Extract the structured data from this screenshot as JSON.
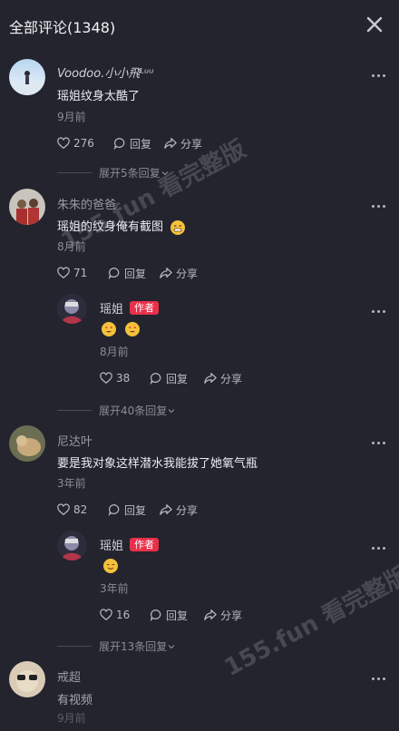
{
  "header": {
    "title": "全部评论(1348)"
  },
  "comments": [
    {
      "name": "Voodoo.小小飛ᴸᵘᵘ",
      "text": "瑶姐纹身太酷了",
      "time": "9月前",
      "likes": "276",
      "reply_label": "回复",
      "share_label": "分享",
      "expand": "展开5条回复"
    },
    {
      "name": "朱朱的爸爸",
      "text": "瑶姐的纹身俺有截图",
      "time": "8月前",
      "likes": "71",
      "reply_label": "回复",
      "share_label": "分享",
      "reply": {
        "name": "瑶姐",
        "tag": "作者",
        "time": "8月前",
        "likes": "38",
        "reply_label": "回复",
        "share_label": "分享"
      },
      "expand": "展开40条回复"
    },
    {
      "name": "尼达叶",
      "text": "要是我对象这样潜水我能拔了她氧气瓶",
      "time": "3年前",
      "likes": "82",
      "reply_label": "回复",
      "share_label": "分享",
      "reply": {
        "name": "瑶姐",
        "tag": "作者",
        "time": "3年前",
        "likes": "16",
        "reply_label": "回复",
        "share_label": "分享"
      },
      "expand": "展开13条回复"
    },
    {
      "name": "戒超",
      "text": "有视频",
      "time": "9月前"
    }
  ],
  "watermark": {
    "text": "155.fun 看完整版"
  },
  "colors": {
    "background": "#23242d",
    "author_tag": "#e8304a",
    "muted": "#8b8b96"
  }
}
